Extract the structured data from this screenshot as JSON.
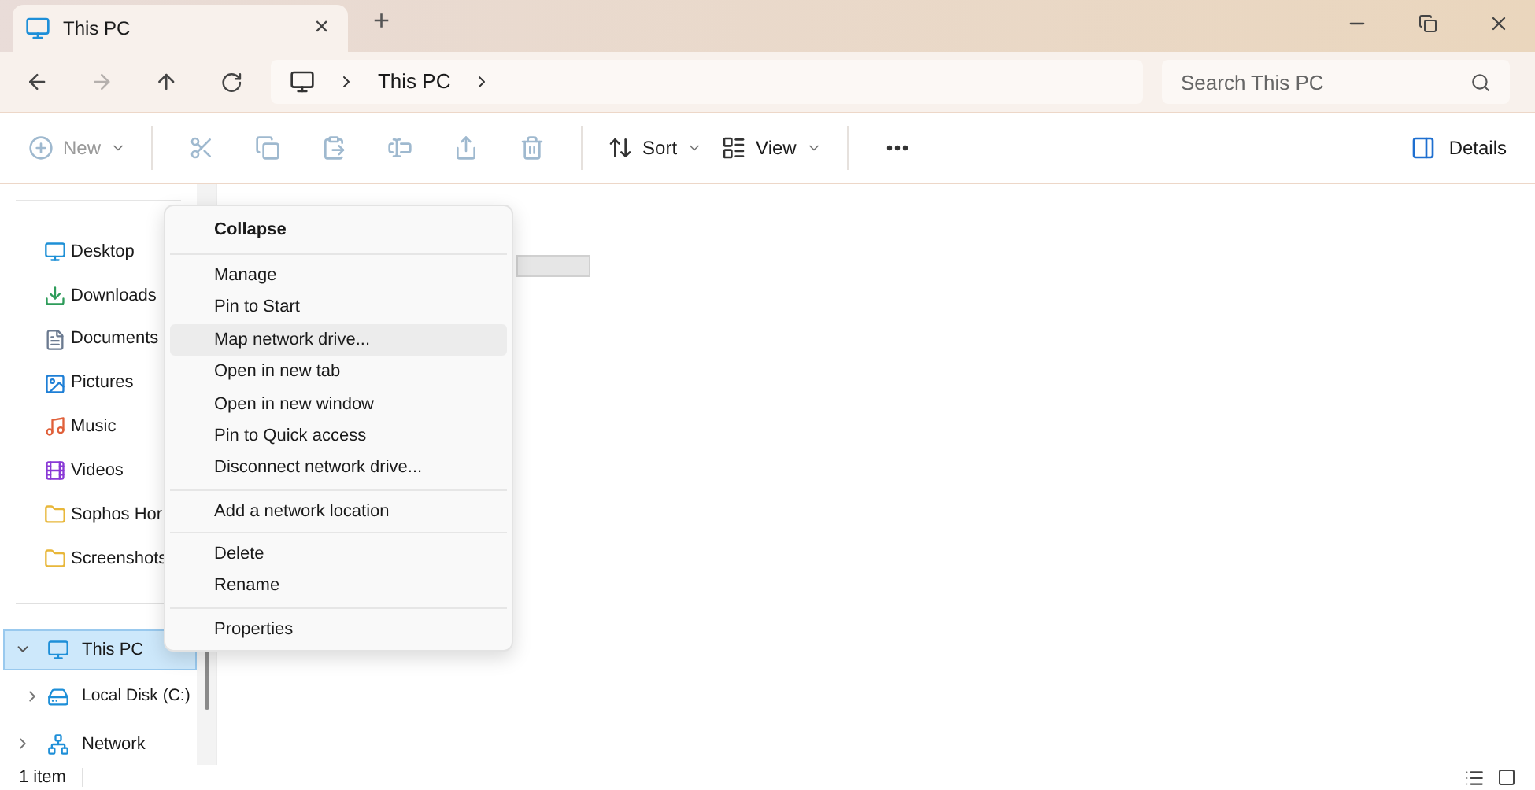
{
  "tab": {
    "title": "This PC",
    "close": "×",
    "new_tab": "+"
  },
  "address": {
    "crumbs": [
      "This PC"
    ],
    "search": {
      "placeholder": "Search This PC"
    }
  },
  "toolbar": [
    {
      "kind": "labeled",
      "label": "New",
      "disabled": true,
      "dropdown": true
    },
    {
      "kind": "icon",
      "disabled": true
    },
    {
      "kind": "icon",
      "disabled": true
    },
    {
      "kind": "icon",
      "disabled": true
    },
    {
      "kind": "icon",
      "disabled": true
    },
    {
      "kind": "icon",
      "disabled": true
    },
    {
      "kind": "icon",
      "disabled": true
    },
    {
      "kind": "labeled",
      "label": "Sort",
      "disabled": false,
      "dropdown": true
    },
    {
      "kind": "labeled",
      "label": "View",
      "disabled": false,
      "dropdown": true
    },
    {
      "kind": "icon",
      "disabled": false
    }
  ],
  "details_button": {
    "label": "Details"
  },
  "sidebar": {
    "quick_items": [
      {
        "label": "Desktop",
        "selected": false
      },
      {
        "label": "Downloads",
        "selected": false
      },
      {
        "label": "Documents",
        "selected": false
      },
      {
        "label": "Pictures",
        "selected": false
      },
      {
        "label": "Music",
        "selected": false
      },
      {
        "label": "Videos",
        "selected": false
      },
      {
        "label": "Sophos Hor",
        "selected": false
      },
      {
        "label": "Screenshots",
        "selected": false
      }
    ],
    "tree": [
      {
        "label": "This PC",
        "expanded": true,
        "selected": true,
        "children": [
          {
            "label": "Local Disk (C:)",
            "expanded": false,
            "selected": false
          }
        ]
      },
      {
        "label": "Network",
        "expanded": false,
        "selected": false
      }
    ]
  },
  "context_menu": {
    "groups": [
      [
        {
          "label": "Collapse",
          "default": true,
          "selected": false
        }
      ],
      [
        {
          "label": "Manage",
          "default": false,
          "selected": false
        },
        {
          "label": "Pin to Start",
          "default": false,
          "selected": false
        },
        {
          "label": "Map network drive...",
          "default": false,
          "selected": true
        },
        {
          "label": "Open in new tab",
          "default": false,
          "selected": false
        },
        {
          "label": "Open in new window",
          "default": false,
          "selected": false
        },
        {
          "label": "Pin to Quick access",
          "default": false,
          "selected": false
        },
        {
          "label": "Disconnect network drive...",
          "default": false,
          "selected": false
        }
      ],
      [
        {
          "label": "Add a network location",
          "default": false,
          "selected": false
        }
      ],
      [
        {
          "label": "Delete",
          "default": false,
          "selected": false
        },
        {
          "label": "Rename",
          "default": false,
          "selected": false
        }
      ],
      [
        {
          "label": "Properties",
          "default": false,
          "selected": false
        }
      ]
    ]
  },
  "status_bar": {
    "count": "1 item"
  }
}
